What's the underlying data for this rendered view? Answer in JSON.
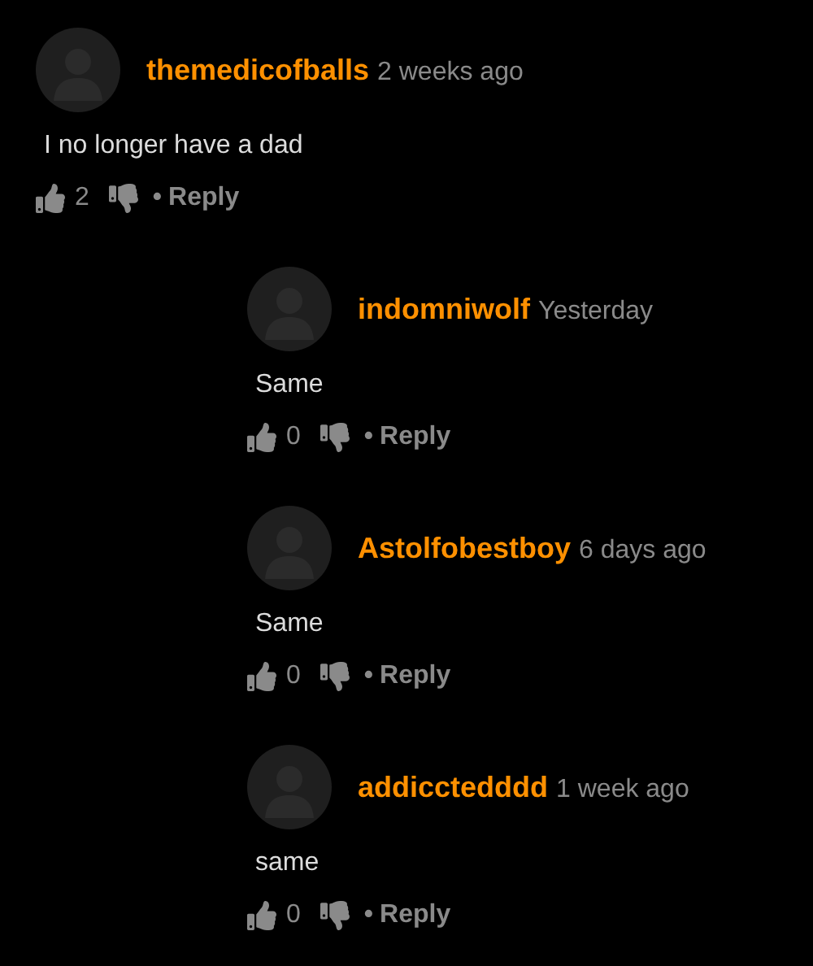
{
  "comment": {
    "username": "themedicofballs",
    "time": "2 weeks ago",
    "text": "I no longer have a dad",
    "likes": "2",
    "separator": "•",
    "reply_label": "Reply",
    "replies": [
      {
        "username": "indomniwolf",
        "time": "Yesterday",
        "text": "Same",
        "likes": "0",
        "separator": "•",
        "reply_label": "Reply"
      },
      {
        "username": "Astolfobestboy",
        "time": "6 days ago",
        "text": "Same",
        "likes": "0",
        "separator": "•",
        "reply_label": "Reply"
      },
      {
        "username": "addicctedddd",
        "time": "1 week ago",
        "text": "same",
        "likes": "0",
        "separator": "•",
        "reply_label": "Reply"
      }
    ]
  }
}
